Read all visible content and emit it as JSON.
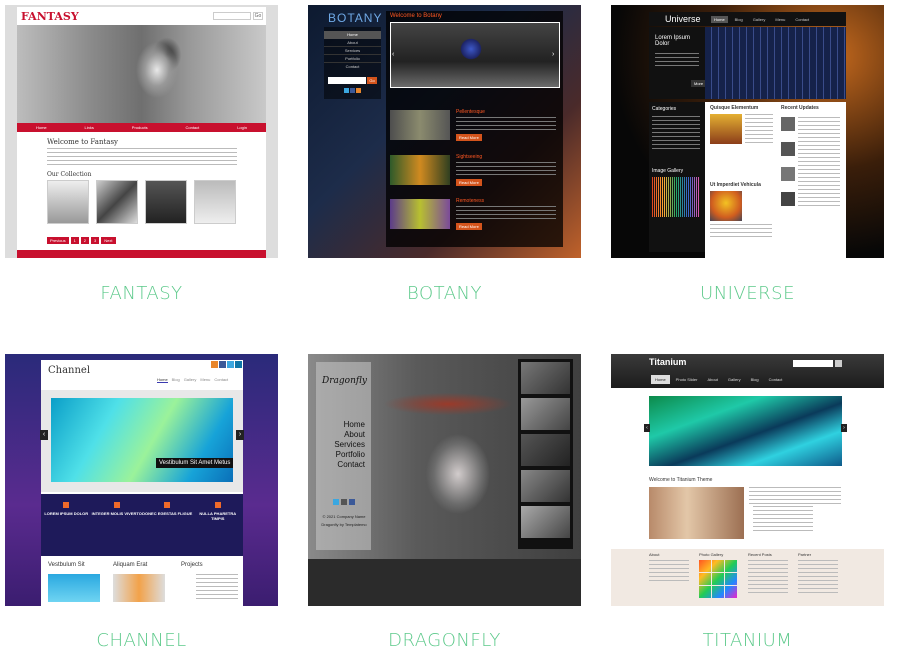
{
  "themes": [
    {
      "caption": "FANTASY"
    },
    {
      "caption": "BOTANY"
    },
    {
      "caption": "UNIVERSE"
    },
    {
      "caption": "CHANNEL"
    },
    {
      "caption": "DRAGONFLY"
    },
    {
      "caption": "TITANIUM"
    }
  ],
  "fantasy": {
    "logo": "FANTASY",
    "search_btn": "Go",
    "welcome": "Welcome to Fantasy",
    "collection": "Our Collection",
    "nav": [
      "Home",
      "Links",
      "Products",
      "Contact",
      "Login"
    ],
    "pager": [
      "Previous",
      "1",
      "2",
      "3",
      "Next"
    ]
  },
  "botany": {
    "logo": "BOTANY",
    "slider_title": "Welcome to Botany",
    "menu": [
      "Home",
      "About",
      "Services",
      "Portfolio",
      "Contact"
    ],
    "search_btn": "Go",
    "sections": [
      "Pellentesque",
      "Sightseeing",
      "Remoteness"
    ],
    "more": "Read More"
  },
  "universe": {
    "logo": "Universe",
    "nav": [
      "Home",
      "Blog",
      "Gallery",
      "Menu",
      "Contact"
    ],
    "banner": "Lorem Ipsum Dolor",
    "more": "More",
    "categories": "Categories",
    "gallery": "Image Gallery",
    "h1": "Quisque Elementum",
    "h2": "Ut Imperdiet Vehicula",
    "recent": "Recent Updates"
  },
  "channel": {
    "logo": "Channel",
    "nav": [
      "Home",
      "Blog",
      "Gallery",
      "Menu",
      "Contact"
    ],
    "slider_caption": "Vestibulum Sit Amet Metus",
    "features": [
      "LOREM IPSUM DOLOR",
      "INTEGER MOLIS VIVERTO",
      "DONEC EGESTAS FLIGUE",
      "NULLA PHARETRA TIMPIS"
    ],
    "cols": [
      "Vestbulum Sit",
      "Aliquam Erat",
      "Projects"
    ]
  },
  "dragonfly": {
    "logo": "Dragonfly",
    "menu": [
      "Home",
      "About",
      "Services",
      "Portfolio",
      "Contact"
    ],
    "copyright": "© 2021 Company Name",
    "credit": "Dragonfly by Templatemo"
  },
  "titanium": {
    "logo": "Titanium",
    "nav": [
      "Home",
      "Photo Slider",
      "About",
      "Gallery",
      "Blog",
      "Contact"
    ],
    "welcome": "Welcome to Titanium Theme",
    "footer": [
      "About",
      "Photo Gallery",
      "Recent Posts",
      "Partner"
    ]
  }
}
